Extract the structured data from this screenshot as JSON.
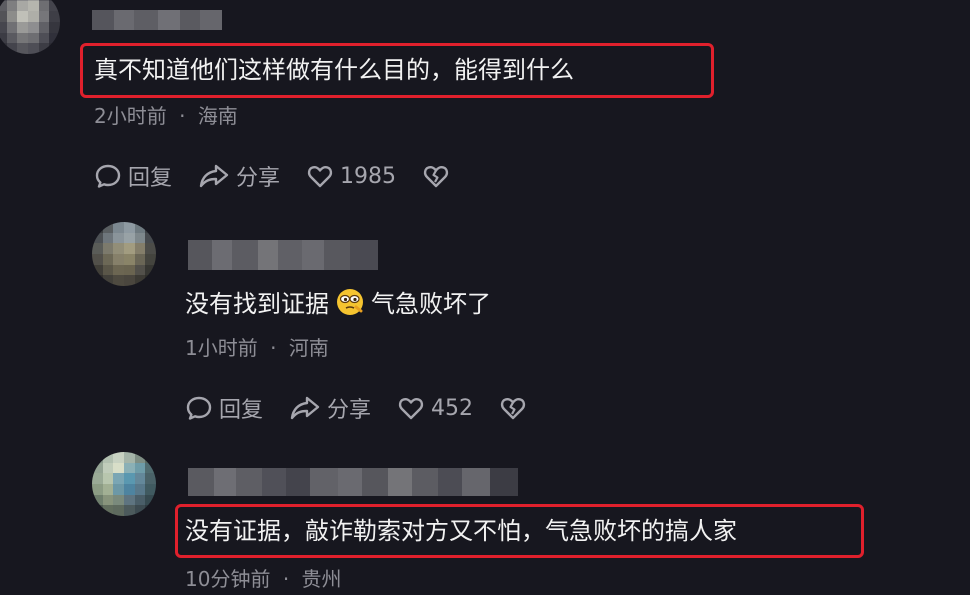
{
  "comments": [
    {
      "text": "真不知道他们这样做有什么目的，能得到什么",
      "time": "2小时前",
      "location": "海南",
      "reply_label": "回复",
      "share_label": "分享",
      "likes": "1985"
    },
    {
      "text_before_emoji": "没有找到证据",
      "emoji": "thinking-face-emoji",
      "text_after_emoji": "气急败坏了",
      "time": "1小时前",
      "location": "河南",
      "reply_label": "回复",
      "share_label": "分享",
      "likes": "452"
    },
    {
      "text": "没有证据，敲诈勒索对方又不怕，气急败坏的搞人家",
      "time": "10分钟前",
      "location": "贵州"
    }
  ],
  "separator": "·",
  "colors": {
    "background": "#17171f",
    "highlight": "#e0202c",
    "meta": "#8e8e96"
  },
  "icons": [
    "comment-bubble-icon",
    "share-arrow-icon",
    "heart-icon",
    "broken-heart-icon"
  ]
}
